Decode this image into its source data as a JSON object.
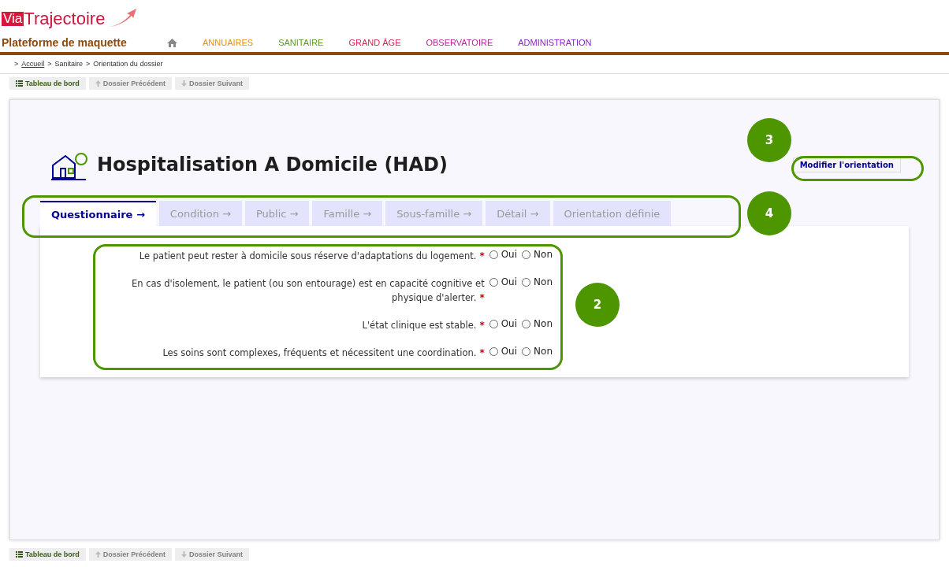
{
  "header": {
    "logo_prefix": "Via",
    "logo_name": "Trajectoire",
    "platform": "Plateforme de maquette",
    "nav": [
      {
        "label": "ANNUAIRES",
        "color": "#e8900a"
      },
      {
        "label": "SANITAIRE",
        "color": "#5a9a1a"
      },
      {
        "label": "GRAND ÂGE",
        "color": "#e0204f"
      },
      {
        "label": "OBSERVATOIRE",
        "color": "#c020a0"
      },
      {
        "label": "ADMINISTRATION",
        "color": "#8a20d0"
      }
    ]
  },
  "breadcrumb": {
    "separator": ">",
    "items": [
      {
        "label": "Accueil",
        "link": true
      },
      {
        "label": "Sanitaire",
        "link": false
      },
      {
        "label": "Orientation du dossier",
        "link": false
      }
    ]
  },
  "toolbar_top": [
    {
      "label": "Tableau de bord",
      "kind": "list",
      "disabled": false
    },
    {
      "label": "Dossier Précédent",
      "kind": "up",
      "disabled": true
    },
    {
      "label": "Dossier Suivant",
      "kind": "down",
      "disabled": true
    }
  ],
  "title": "Hospitalisation A Domicile (HAD)",
  "modify_button": "Modifier l'orientation",
  "tabs": [
    {
      "label": "Questionnaire →",
      "selected": true
    },
    {
      "label": "Condition →",
      "selected": false
    },
    {
      "label": "Public →",
      "selected": false
    },
    {
      "label": "Famille →",
      "selected": false
    },
    {
      "label": "Sous-famille →",
      "selected": false
    },
    {
      "label": "Détail →",
      "selected": false
    },
    {
      "label": "Orientation définie",
      "selected": false
    }
  ],
  "questions": [
    {
      "text": "Le patient peut rester à domicile sous réserve d'adaptations du logement.",
      "required_mark": "*",
      "options": [
        {
          "label": "Oui",
          "selected": false
        },
        {
          "label": "Non",
          "selected": false
        }
      ]
    },
    {
      "text": "En cas d'isolement, le patient (ou son entourage) est en capacité cognitive et physique d'alerter.",
      "required_mark": "*",
      "options": [
        {
          "label": "Oui",
          "selected": false
        },
        {
          "label": "Non",
          "selected": false
        }
      ]
    },
    {
      "text": "L'état clinique est stable.",
      "required_mark": "*",
      "options": [
        {
          "label": "Oui",
          "selected": false
        },
        {
          "label": "Non",
          "selected": false
        }
      ]
    },
    {
      "text": "Les soins sont complexes, fréquents et nécessitent une coordination.",
      "required_mark": "*",
      "options": [
        {
          "label": "Oui",
          "selected": false
        },
        {
          "label": "Non",
          "selected": false
        }
      ]
    }
  ],
  "annotations": [
    {
      "label": "3"
    },
    {
      "label": "4"
    },
    {
      "label": "2"
    }
  ],
  "toolbar_bottom": [
    {
      "label": "Tableau de bord",
      "kind": "list",
      "disabled": false
    },
    {
      "label": "Dossier Précédent",
      "kind": "up",
      "disabled": true
    },
    {
      "label": "Dossier Suivant",
      "kind": "down",
      "disabled": true
    }
  ]
}
